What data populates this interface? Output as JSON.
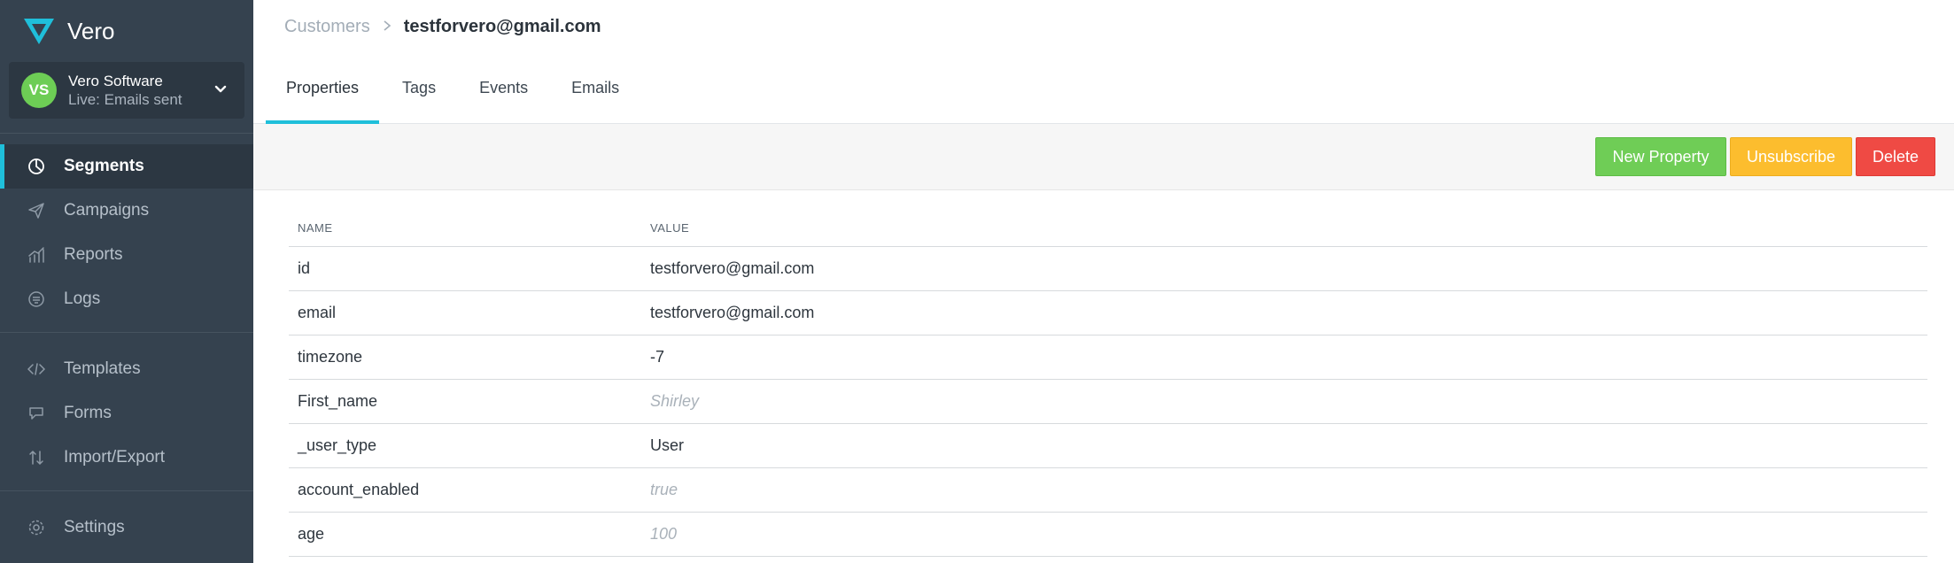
{
  "brand": {
    "name": "Vero",
    "accent": "#1fbfda"
  },
  "account": {
    "initials": "VS",
    "name": "Vero Software",
    "status": "Live: Emails sent"
  },
  "nav": {
    "segments": "Segments",
    "campaigns": "Campaigns",
    "reports": "Reports",
    "logs": "Logs",
    "templates": "Templates",
    "forms": "Forms",
    "import_export": "Import/Export",
    "settings": "Settings"
  },
  "breadcrumb": {
    "parent": "Customers",
    "current": "testforvero@gmail.com"
  },
  "tabs": {
    "properties": "Properties",
    "tags": "Tags",
    "events": "Events",
    "emails": "Emails"
  },
  "toolbar": {
    "new_property": "New Property",
    "unsubscribe": "Unsubscribe",
    "delete": "Delete"
  },
  "table": {
    "headers": {
      "name": "NAME",
      "value": "VALUE"
    },
    "rows": [
      {
        "name": "id",
        "value": "testforvero@gmail.com",
        "muted": false
      },
      {
        "name": "email",
        "value": "testforvero@gmail.com",
        "muted": false
      },
      {
        "name": "timezone",
        "value": "-7",
        "muted": false
      },
      {
        "name": "First_name",
        "value": "Shirley",
        "muted": true
      },
      {
        "name": "_user_type",
        "value": "User",
        "muted": false
      },
      {
        "name": "account_enabled",
        "value": "true",
        "muted": true
      },
      {
        "name": "age",
        "value": "100",
        "muted": true
      }
    ]
  }
}
